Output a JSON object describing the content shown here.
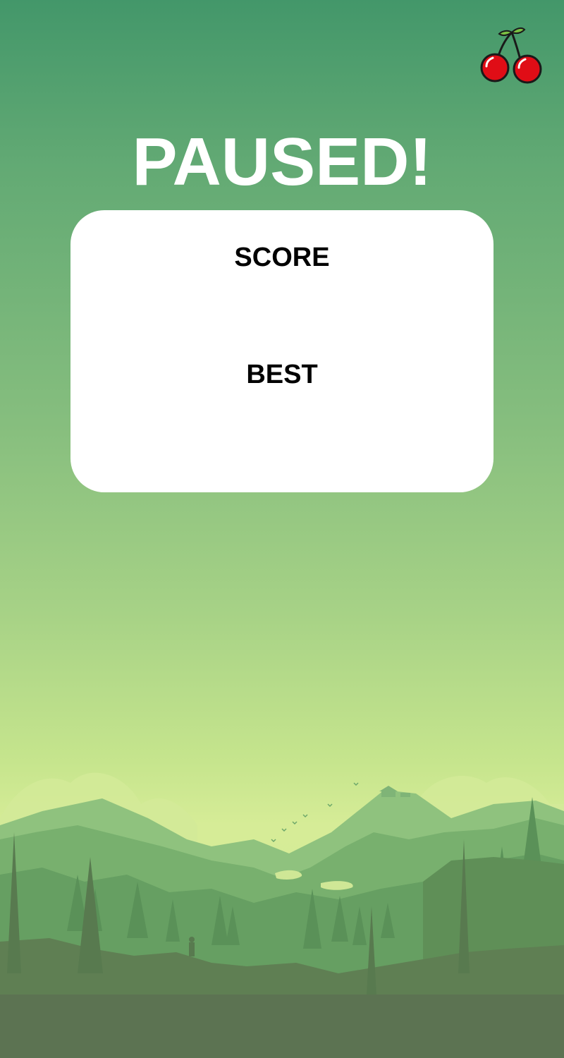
{
  "game": {
    "status_title": "PAUSED!",
    "score_label": "SCORE",
    "best_label": "BEST",
    "menu_icon": "cherry-icon"
  },
  "colors": {
    "title": "#ffffff",
    "card_background": "#ffffff",
    "card_text": "#000000",
    "sky_top": "#43976a",
    "sky_bottom": "#d6ec97",
    "cherry_red": "#e00d16",
    "leaf_green": "#7bc043"
  }
}
